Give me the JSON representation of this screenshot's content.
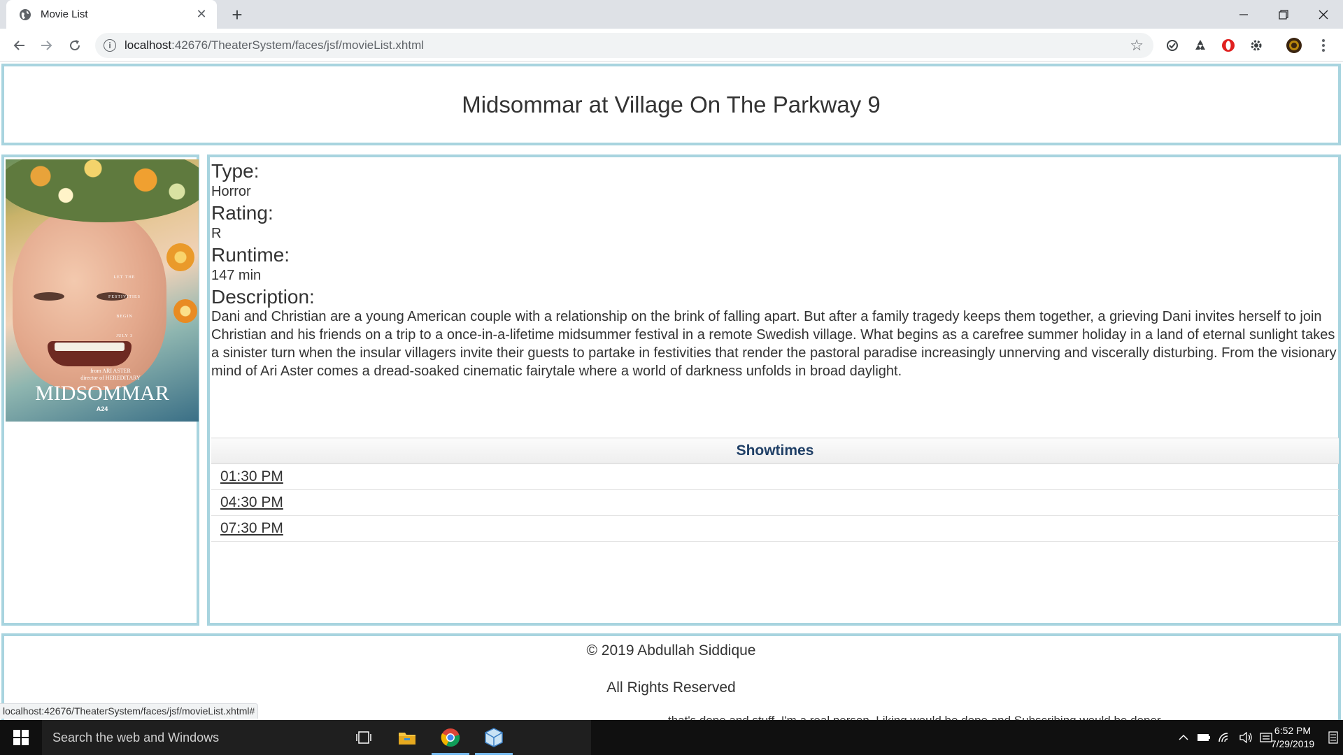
{
  "browser": {
    "tab_title": "Movie List",
    "url_host": "localhost",
    "url_rest": ":42676/TheaterSystem/faces/jsf/movieList.xhtml"
  },
  "page": {
    "title": "Midsommar at Village On The Parkway 9",
    "poster": {
      "credits": [
        "LET THE",
        "FESTIVITIES",
        "BEGIN",
        "JULY 3"
      ],
      "from": "from ARI ASTER",
      "director_of": "director of HEREDITARY",
      "wordmark": "MIDSOMMAR",
      "studio": "A24"
    },
    "fields": {
      "type_label": "Type:",
      "type_value": "Horror",
      "rating_label": "Rating:",
      "rating_value": "R",
      "runtime_label": "Runtime:",
      "runtime_value": "147 min",
      "description_label": "Description:",
      "description_value": "Dani and Christian are a young American couple with a relationship on the brink of falling apart. But after a family tragedy keeps them together, a grieving Dani invites herself to join Christian and his friends on a trip to a once-in-a-lifetime midsummer festival in a remote Swedish village. What begins as a carefree summer holiday in a land of eternal sunlight takes a sinister turn when the insular villagers invite their guests to partake in festivities that render the pastoral paradise increasingly unnerving and viscerally disturbing. From the visionary mind of Ari Aster comes a dread-soaked cinematic fairytale where a world of darkness unfolds in broad daylight."
    },
    "showtimes": {
      "header": "Showtimes",
      "times": [
        "01:30 PM",
        "04:30 PM",
        "07:30 PM"
      ]
    },
    "footer": {
      "copyright": "© 2019 Abdullah Siddique",
      "rights": "All Rights Reserved"
    }
  },
  "status_url": "localhost:42676/TheaterSystem/faces/jsf/movieList.xhtml#",
  "behind_text": "that's dope and stuff. I'm a real person. Liking would be dope and Subscribing would be doper.",
  "taskbar": {
    "search_placeholder": "Search the web and Windows",
    "time": "6:52 PM",
    "date": "7/29/2019"
  },
  "colors": {
    "panel_border": "#a8d4df",
    "showtimes_header_text": "#1f3f66",
    "taskbar_bg": "#101010"
  }
}
